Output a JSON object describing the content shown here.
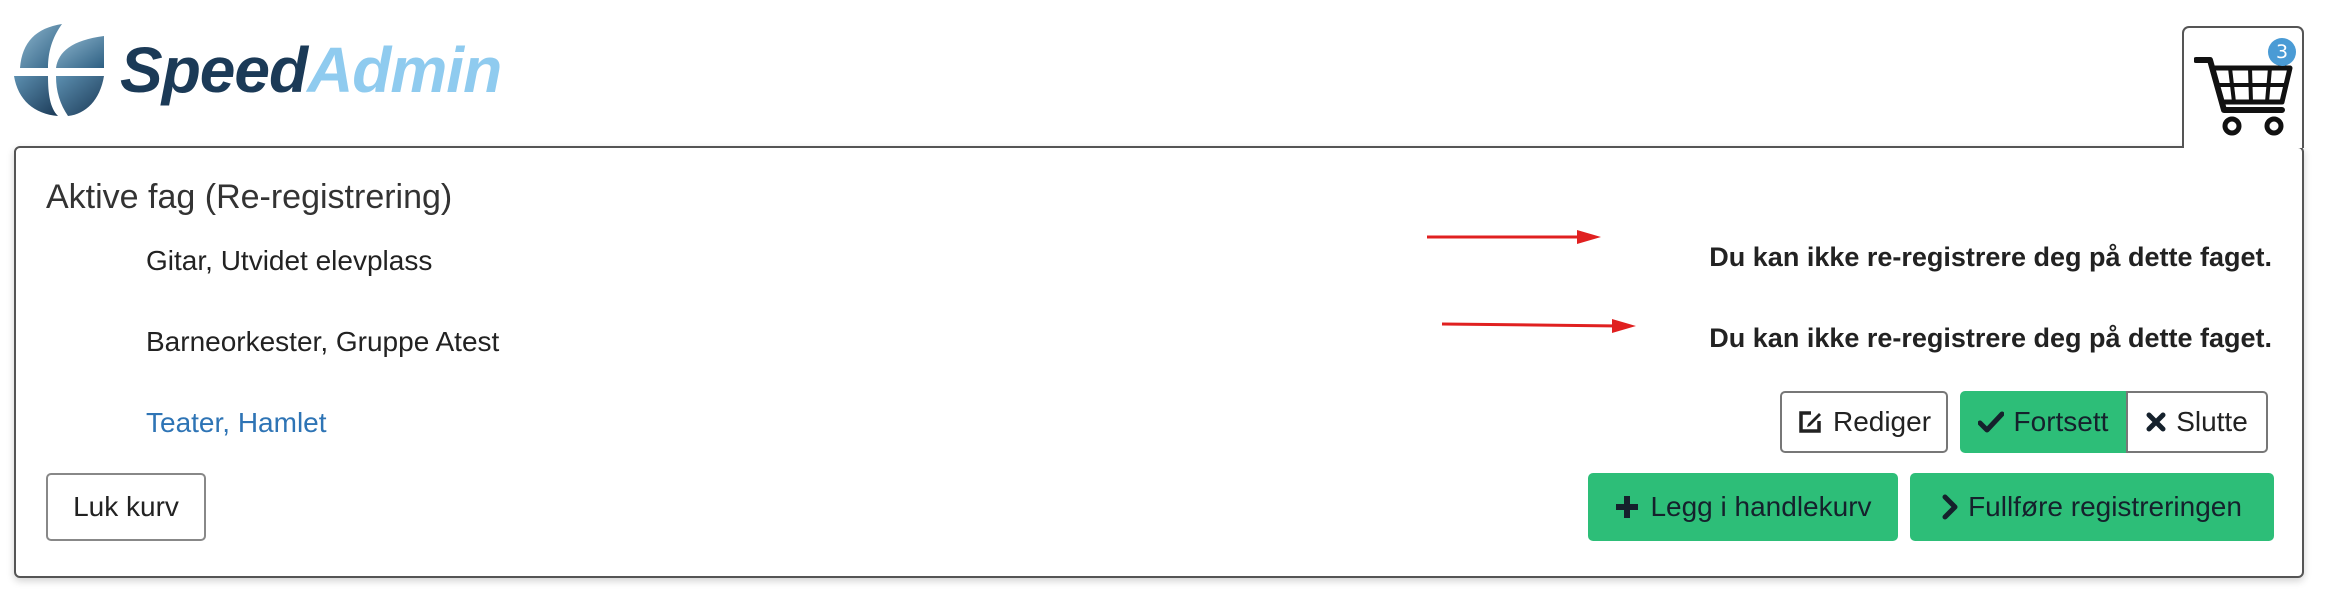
{
  "brand": {
    "name_part1": "Speed",
    "name_part2": "Admin",
    "colors": {
      "dark": "#1b3a57",
      "light": "#8fcbef"
    }
  },
  "cart": {
    "icon": "shopping-cart-icon",
    "count": "3"
  },
  "panel": {
    "title": "Aktive fag (Re-registrering)",
    "rows": [
      {
        "label": "Gitar, Utvidet elevplass",
        "message": "Du kan ikke re-registrere deg på dette faget."
      },
      {
        "label": "Barneorkester, Gruppe Atest",
        "message": "Du kan ikke re-registrere deg på dette faget."
      },
      {
        "label": "Teater, Hamlet",
        "actions": {
          "edit": "Rediger",
          "continue": "Fortsett",
          "quit": "Slutte"
        }
      }
    ],
    "footer": {
      "close_cart": "Luk kurv",
      "add_to_cart": "Legg i handlekurv",
      "complete": "Fullføre registreringen"
    }
  },
  "colors": {
    "success": "#2dbe78",
    "link": "#2e74b5",
    "annotation_arrow": "#e02020",
    "badge": "#4a9bd5"
  }
}
